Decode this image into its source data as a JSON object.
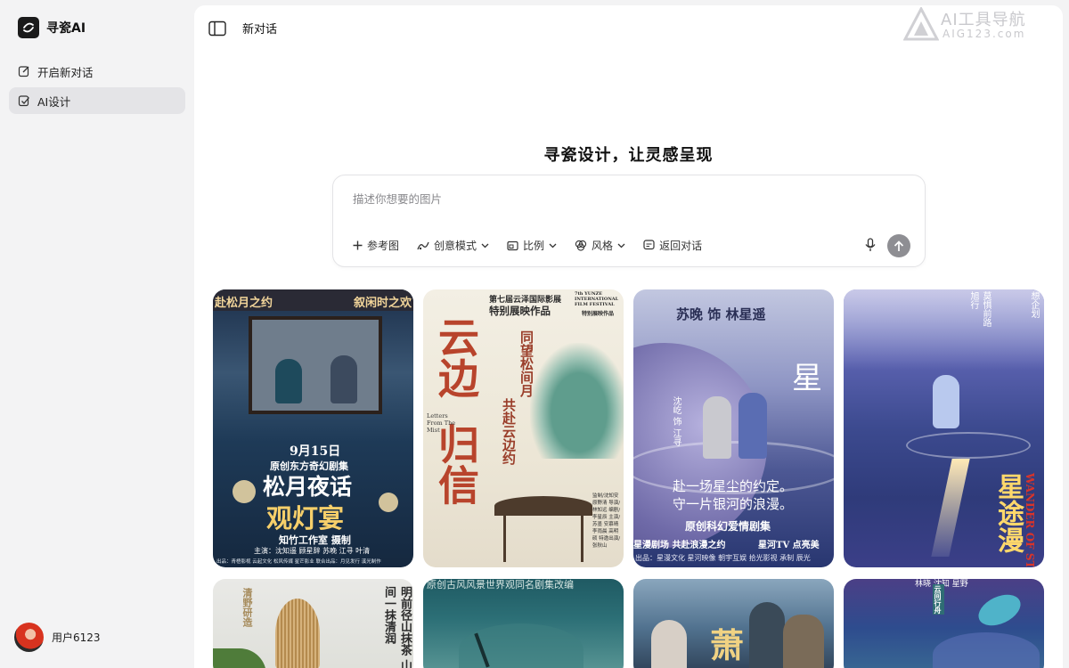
{
  "brand": {
    "name": "寻瓷AI"
  },
  "sidebar": {
    "items": [
      {
        "label": "开启新对话",
        "icon": "edit-icon"
      },
      {
        "label": "AI设计",
        "icon": "design-icon"
      }
    ]
  },
  "user": {
    "name": "用户6123"
  },
  "topbar": {
    "title": "新对话"
  },
  "headline": "寻瓷设计，让灵感呈现",
  "prompt": {
    "placeholder": "描述你想要的图片",
    "tools": {
      "reference": "参考图",
      "mode": "创意模式",
      "ratio": "比例",
      "style": "风格",
      "back": "返回对话"
    }
  },
  "watermark": {
    "title": "AI工具导航",
    "sub": "AIG123.com"
  },
  "gallery": {
    "card1": {
      "top_left": "赴松月之约",
      "top_right": "叙闲时之欢",
      "date": "9月15日",
      "subtitle": "原创东方奇幻剧集",
      "title1": "松月夜话",
      "title2": "观灯宴",
      "studio": "知竹工作室 摄制",
      "cast": "主演：沈知遥 顾星辞 苏晚 江寻 叶清",
      "credits": "出品：青梧影视 云起文化 松风传媒 星芒影业 联合出品：月见发行 溪光制作"
    },
    "card2": {
      "festival": "第七届云泽国际影展",
      "festival_sub": "特别展映作品",
      "festival_en": "7th YUNZE INTERNATIONAL FILM FESTIVAL",
      "festival_en_sub": "特别展映作品",
      "big1": "云边",
      "big2": "归信",
      "poem1": "同望松间月",
      "poem2": "共赴云边约",
      "en": "Letters From The Mist",
      "credits": "监制/沈知安 原野清 导演/林知远 编剧/李星辰 主演/苏墨 安慕晴 李雨晨 高明硕 特邀出演/张秋山"
    },
    "card3": {
      "cast_top": "苏晚 饰 林星遥",
      "star": "星",
      "role": "沈屹 饰 江寻",
      "line1": "赴一场星尘的约定。",
      "line2": "守一片银河的浪漫。",
      "genre": "原创科幻爱情剧集",
      "tag1": "星漫剧场 共赴浪漫之约",
      "tag2": "星河TV 点亮美",
      "credits": "出品：星漫文化 星河映像 朝宇互娱 拾光影视 承制 辰光"
    },
    "card4": {
      "top1": "旭行",
      "top2": "莫惧前路",
      "top3": "想企划",
      "title": "星途漫",
      "en": "WANDER OF STA"
    },
    "card5": {
      "label1": "清野研造",
      "poem": "明前径山抹茶 山间一抹清润"
    },
    "card6": {
      "label": "原创古风风景世界观同名剧集改编"
    },
    "card7": {
      "label": "萧"
    },
    "card8": {
      "label": "林晓 沈知 星野",
      "tag": "云间行舟"
    }
  }
}
